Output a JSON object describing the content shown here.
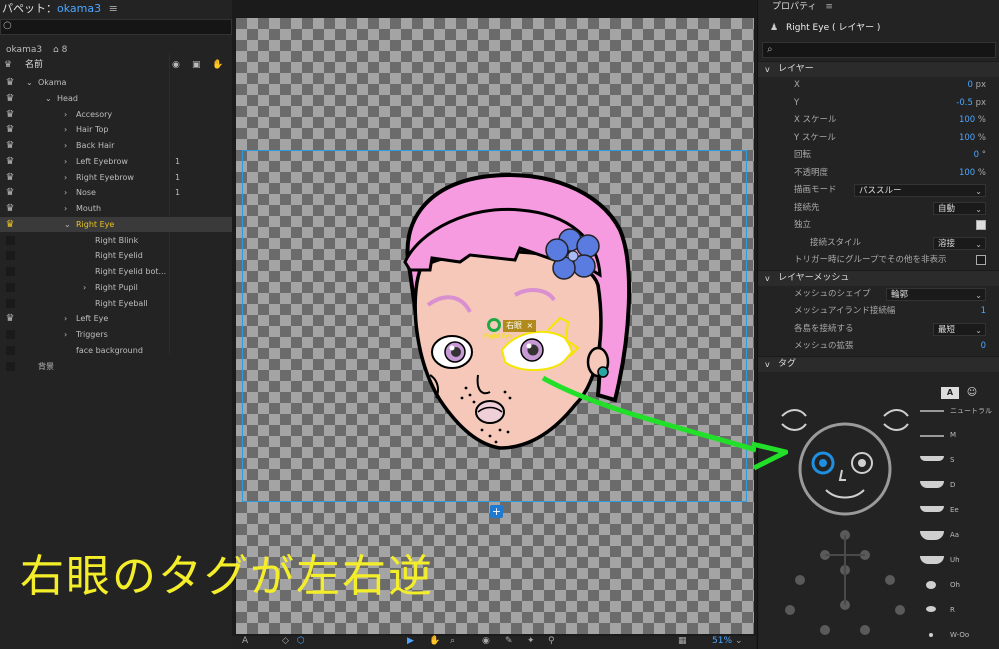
{
  "left_panel": {
    "title_prefix": "パペット：",
    "title_name": "okama3",
    "menu_icon": "≡",
    "search_icon": "○",
    "puppet_name": "okama3",
    "puppet_count": "8",
    "col_name": "名前",
    "tree": [
      {
        "label": "Okama",
        "indent": 0,
        "expander": "v",
        "crown": true,
        "num": ""
      },
      {
        "label": "Head",
        "indent": 1,
        "expander": "v",
        "crown": true,
        "num": ""
      },
      {
        "label": "Accesory",
        "indent": 2,
        "expander": ">",
        "crown": true,
        "num": ""
      },
      {
        "label": "Hair Top",
        "indent": 2,
        "expander": ">",
        "crown": true,
        "num": ""
      },
      {
        "label": "Back Hair",
        "indent": 2,
        "expander": ">",
        "crown": true,
        "num": ""
      },
      {
        "label": "Left Eyebrow",
        "indent": 2,
        "expander": ">",
        "crown": true,
        "num": "1"
      },
      {
        "label": "Right Eyebrow",
        "indent": 2,
        "expander": ">",
        "crown": true,
        "num": "1"
      },
      {
        "label": "Nose",
        "indent": 2,
        "expander": ">",
        "crown": true,
        "num": "1"
      },
      {
        "label": "Mouth",
        "indent": 2,
        "expander": ">",
        "crown": true,
        "num": ""
      },
      {
        "label": "Right Eye",
        "indent": 2,
        "expander": "v",
        "crown": true,
        "num": "",
        "selected": true
      },
      {
        "label": "Right Blink",
        "indent": 3,
        "expander": "",
        "crown": false,
        "num": ""
      },
      {
        "label": "Right Eyelid",
        "indent": 3,
        "expander": "",
        "crown": false,
        "num": ""
      },
      {
        "label": "Right Eyelid bot...",
        "indent": 3,
        "expander": "",
        "crown": false,
        "num": ""
      },
      {
        "label": "Right Pupil",
        "indent": 3,
        "expander": ">",
        "crown": false,
        "num": ""
      },
      {
        "label": "Right Eyeball",
        "indent": 3,
        "expander": "",
        "crown": false,
        "num": ""
      },
      {
        "label": "Left Eye",
        "indent": 2,
        "expander": ">",
        "crown": true,
        "num": ""
      },
      {
        "label": "Triggers",
        "indent": 2,
        "expander": ">",
        "crown": false,
        "num": ""
      },
      {
        "label": "face background",
        "indent": 2,
        "expander": "",
        "crown": false,
        "num": ""
      },
      {
        "label": "背景",
        "indent": 0,
        "expander": "",
        "crown": false,
        "num": ""
      }
    ]
  },
  "canvas": {
    "handle_label": "右眼",
    "handle_sub": "Right Eye",
    "handle_close": "×",
    "zoom": "51%",
    "caption": "右眼のタグが左右逆"
  },
  "right_panel": {
    "title": "プロパティ",
    "menu_icon": "≡",
    "layer_name": "Right Eye ( レイヤー )",
    "search_icon": "⌕",
    "section_layer": "レイヤー",
    "props": {
      "x_label": "X",
      "x_value": "0",
      "x_unit": "px",
      "y_label": "Y",
      "y_value": "-0.5",
      "y_unit": "px",
      "xs_label": "X スケール",
      "xs_value": "100",
      "xs_unit": "%",
      "ys_label": "Y スケール",
      "ys_value": "100",
      "ys_unit": "%",
      "rot_label": "回転",
      "rot_value": "0",
      "rot_unit": "°",
      "op_label": "不透明度",
      "op_value": "100",
      "op_unit": "%",
      "blend_label": "描画モード",
      "blend_value": "パススルー",
      "attach_label": "接続先",
      "attach_value": "自動",
      "indep_label": "独立",
      "attach_style_label": "接続スタイル",
      "attach_style_value": "溶接",
      "trigger_label": "トリガー時にグループでその他を非表示"
    },
    "section_mesh": "レイヤーメッシュ",
    "mesh": {
      "shape_label": "メッシュのシェイプ",
      "shape_value": "輪郭",
      "island_label": "メッシュアイランド接続幅",
      "island_value": "1",
      "connect_label": "各島を接続する",
      "connect_value": "最短",
      "expand_label": "メッシュの拡張",
      "expand_value": "0"
    },
    "section_tag": "タグ",
    "tag_buttons": [
      "A",
      "☺"
    ],
    "visemes": [
      "ニュートラル",
      "M",
      "S",
      "D",
      "Ee",
      "Aa",
      "Uh",
      "Oh",
      "R",
      "W-Oo"
    ]
  },
  "colors": {
    "accent": "#4da6ff",
    "selection": "#e8c320",
    "caption": "#f4ee2a",
    "arrow": "#22e02a",
    "tag_highlight": "#1f8fe0"
  }
}
